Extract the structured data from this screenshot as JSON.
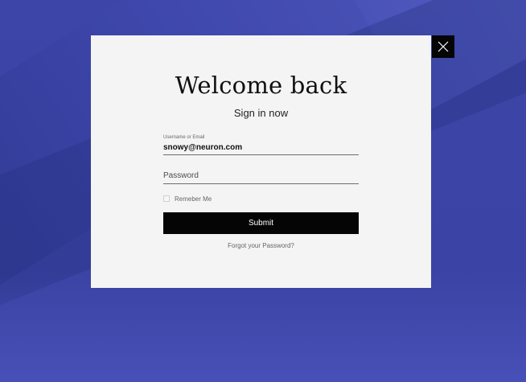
{
  "modal": {
    "title": "Welcome back",
    "subtitle": "Sign in now",
    "username": {
      "label": "Username or Email",
      "value": "snowy@neuron.com"
    },
    "password": {
      "placeholder": "Password"
    },
    "remember_label": "Remeber Me",
    "submit_label": "Submit",
    "forgot_label": "Forgot your Password?"
  },
  "icons": {
    "close": "close-icon"
  },
  "colors": {
    "background": "#3f46a6",
    "modal": "#f4f4f4",
    "button": "#050505"
  }
}
